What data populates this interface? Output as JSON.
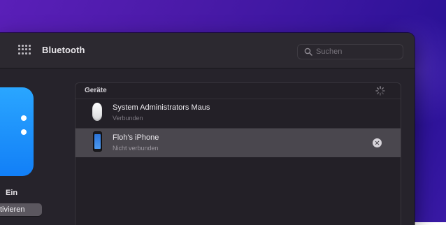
{
  "toolbar": {
    "title": "Bluetooth",
    "icon": "grid-icon",
    "search": {
      "placeholder": "Suchen",
      "value": ""
    }
  },
  "bluetooth": {
    "icon": "bluetooth-icon",
    "state": "Ein",
    "toggle_label": "tivieren"
  },
  "devices": {
    "title": "Geräte",
    "spinner_icon": "spinner-icon",
    "items": [
      {
        "name": "System Administrators Maus",
        "status": "Verbunden",
        "icon": "mouse-icon"
      },
      {
        "name": "Floh's iPhone",
        "status": "Nicht verbunden",
        "icon": "iphone-icon",
        "action_icon": "remove-icon"
      }
    ]
  },
  "colors": {
    "accent_blue": "#127ff7",
    "selected_row": "#4a474e",
    "window_bg": "#26232b"
  }
}
